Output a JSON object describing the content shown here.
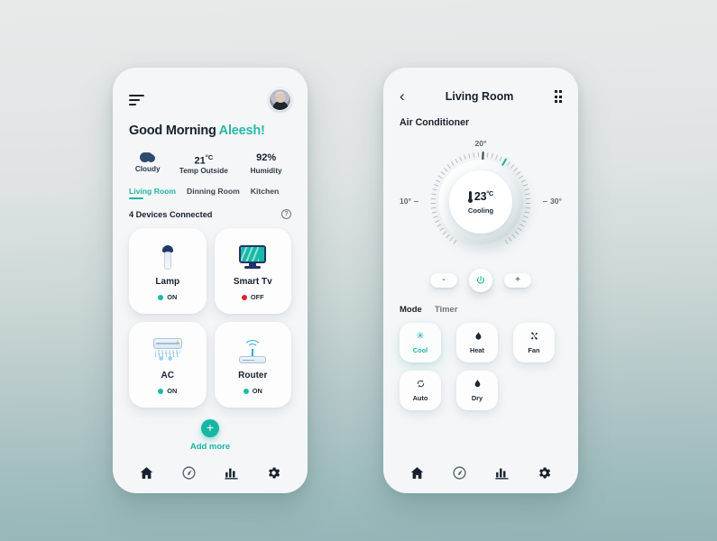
{
  "home": {
    "menu_icon": "hamburger-icon",
    "avatar": "user-avatar",
    "greeting": "Good Morning",
    "user_name": "Aleesh!",
    "weather": [
      {
        "value": "",
        "icon": "cloud-icon",
        "label": "Cloudy"
      },
      {
        "value": "21",
        "unit": "°C",
        "label": "Temp Outside"
      },
      {
        "value": "92%",
        "unit": "",
        "label": "Humidity"
      }
    ],
    "room_tabs": [
      {
        "label": "Living Room",
        "active": true
      },
      {
        "label": "Dinning Room",
        "active": false
      },
      {
        "label": "Kitchen",
        "active": false
      }
    ],
    "devices_header": "4 Devices Connected",
    "help_icon": "question-mark-icon",
    "devices": [
      {
        "name": "Lamp",
        "state": "ON",
        "icon": "lamp-icon"
      },
      {
        "name": "Smart Tv",
        "state": "OFF",
        "icon": "television-icon"
      },
      {
        "name": "AC",
        "state": "ON",
        "icon": "air-conditioner-icon"
      },
      {
        "name": "Router",
        "state": "ON",
        "icon": "router-icon"
      }
    ],
    "add_more_label": "Add more",
    "add_more_icon": "plus-icon"
  },
  "ac": {
    "back_icon": "chevron-left-icon",
    "title": "Living Room",
    "grid_icon": "grid-dots-icon",
    "subtitle": "Air Conditioner",
    "dial": {
      "top_label": "20°",
      "left_label": "10°",
      "right_label": "30°",
      "temperature": "23",
      "unit": "°C",
      "status": "Cooling",
      "thermometer_icon": "thermometer-icon"
    },
    "controls": {
      "decrease": "-",
      "power_icon": "power-icon",
      "increase": "+"
    },
    "mode_tabs": [
      {
        "label": "Mode",
        "active": true
      },
      {
        "label": "Timer",
        "active": false
      }
    ],
    "modes": [
      {
        "label": "Cool",
        "icon": "snowflake-icon",
        "glyph": "✳",
        "active": true
      },
      {
        "label": "Heat",
        "icon": "flame-icon",
        "glyph": "ὒ5",
        "active": false
      },
      {
        "label": "Fan",
        "icon": "fan-icon",
        "glyph": "✦",
        "active": false
      },
      {
        "label": "Auto",
        "icon": "refresh-icon",
        "glyph": "↻",
        "active": false
      },
      {
        "label": "Dry",
        "icon": "water-drop-icon",
        "glyph": "Ὂ7",
        "active": false
      }
    ]
  },
  "bottom_nav": [
    {
      "icon": "home-icon",
      "active": true
    },
    {
      "icon": "speedometer-icon",
      "active": false
    },
    {
      "icon": "bar-chart-icon",
      "active": false
    },
    {
      "icon": "gear-icon",
      "active": false
    }
  ],
  "colors": {
    "accent_teal": "#1fb4a3",
    "dark_navy": "#16212f",
    "status_on": "#1cb9a8",
    "status_off": "#d8232a",
    "card_bg": "#fdfdfd",
    "phone_bg": "#f4f6f7"
  }
}
